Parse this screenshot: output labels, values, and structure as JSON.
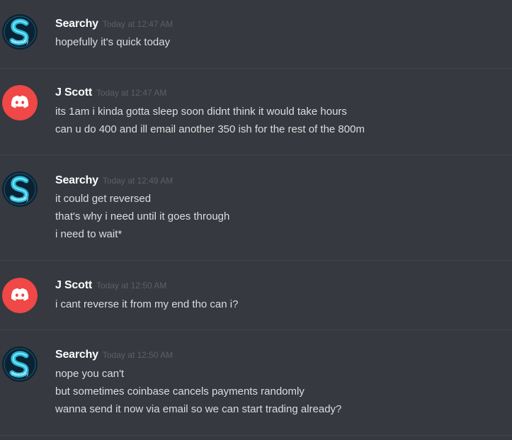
{
  "colors": {
    "background": "#36393f",
    "username": "#ffffff",
    "timestamp": "#5e6065",
    "message_text": "#dcddde",
    "discord_avatar_red": "#f04747",
    "searchy_avatar_dark": "#0b2233",
    "searchy_avatar_teal": "#29b8d8"
  },
  "messages": [
    {
      "author": "Searchy",
      "avatar": "searchy-avatar",
      "timestamp": "Today at 12:47 AM",
      "lines": [
        "hopefully it's quick today"
      ]
    },
    {
      "author": "J Scott",
      "avatar": "discord-default-avatar",
      "timestamp": "Today at 12:47 AM",
      "lines": [
        "its 1am i kinda gotta sleep soon didnt think it would take hours",
        "can u do 400 and ill email another 350 ish for the rest of the 800m"
      ]
    },
    {
      "author": "Searchy",
      "avatar": "searchy-avatar",
      "timestamp": "Today at 12:49 AM",
      "lines": [
        "it could get reversed",
        "that's why i need until it goes through",
        "i need to wait*"
      ]
    },
    {
      "author": "J Scott",
      "avatar": "discord-default-avatar",
      "timestamp": "Today at 12:50 AM",
      "lines": [
        "i cant reverse it from my end tho can i?"
      ]
    },
    {
      "author": "Searchy",
      "avatar": "searchy-avatar",
      "timestamp": "Today at 12:50 AM",
      "lines": [
        "nope you can't",
        "but sometimes coinbase cancels payments randomly",
        "wanna send it now via email so we can start trading already?"
      ]
    }
  ]
}
